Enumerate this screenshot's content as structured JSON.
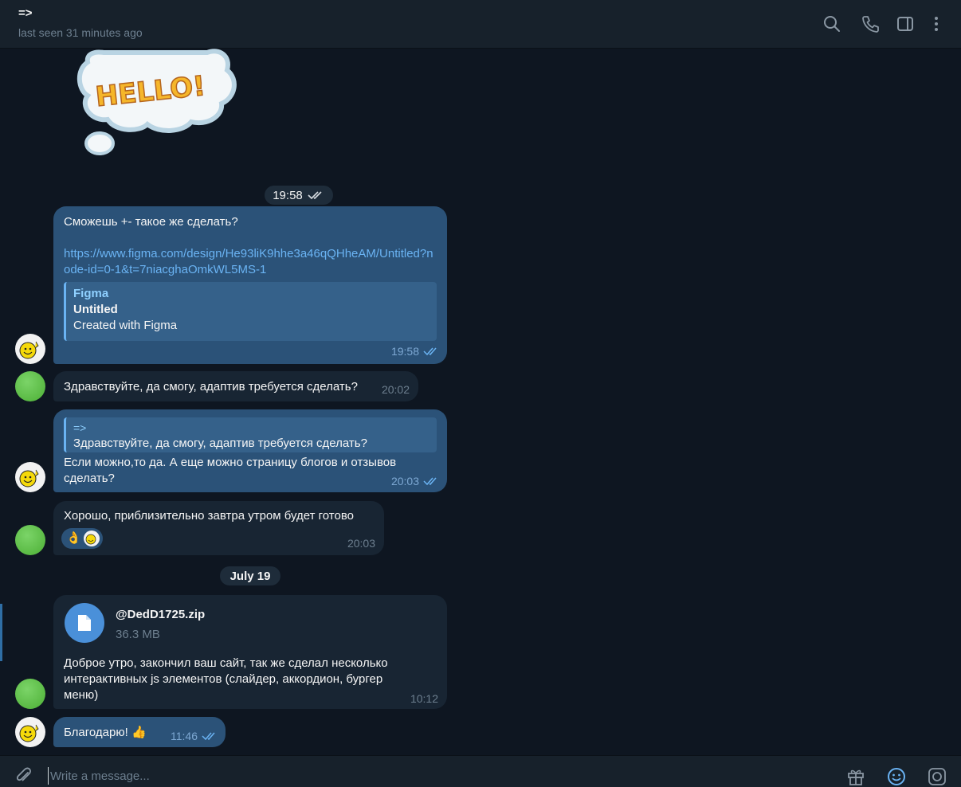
{
  "header": {
    "title": "=>",
    "status": "last seen 31 minutes ago",
    "icons": [
      "search-icon",
      "phone-icon",
      "sidebar-toggle-icon",
      "more-vertical-icon"
    ]
  },
  "messages": {
    "time_pill": "19:58",
    "m1": {
      "text": "Сможешь +- такое же сделать?",
      "link": "https://www.figma.com/design/He93liK9hhe3a46qQHheAM/Untitled?node-id=0-1&t=7niacghaOmkWL5MS-1",
      "preview_site": "Figma",
      "preview_title": "Untitled",
      "preview_desc": "Created with Figma",
      "time": "19:58"
    },
    "m2": {
      "text": "Здравствуйте, да смогу, адаптив требуется сделать?",
      "time": "20:02"
    },
    "m3": {
      "reply_name": "=>",
      "reply_text": "Здравствуйте, да смогу, адаптив требуется сделать?",
      "text": "Если можно,то да. А еще можно страницу блогов и отзывов сделать?",
      "time": "20:03"
    },
    "m4": {
      "text": "Хорошо, приблизительно завтра утром будет готово",
      "reaction": "👌",
      "time": "20:03"
    },
    "date_pill": "July 19",
    "m5": {
      "file_name": "@DedD1725.zip",
      "file_size": "36.3 MB",
      "text": "Доброе утро, закончил ваш сайт, так же сделал несколько интерактивных js элементов (слайдер, аккордион, бургер меню)",
      "time": "10:12"
    },
    "m6": {
      "text": "Благодарю! 👍",
      "time": "11:46"
    }
  },
  "composer": {
    "placeholder": "Write a message...",
    "icons": [
      "attach-icon",
      "gift-icon",
      "emoji-icon",
      "camera-icon"
    ]
  },
  "colors": {
    "background": "#0e1621",
    "header": "#17212b",
    "outgoing": "#2b5278",
    "incoming": "#182533",
    "accent": "#6ab3f3"
  }
}
